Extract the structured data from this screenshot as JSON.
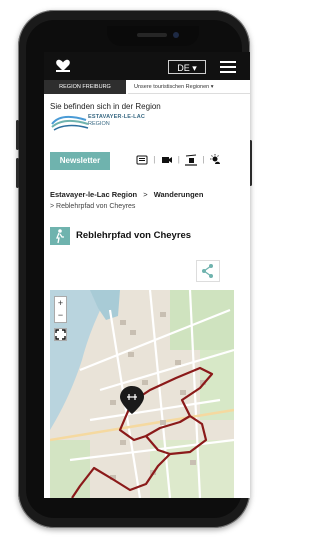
{
  "header": {
    "language": "DE ▾"
  },
  "region_bar": {
    "left": "REGION FREIBURG",
    "right": "Unsere touristischen Regionen ▾"
  },
  "region": {
    "intro": "Sie befinden sich in der Region",
    "name_line1": "ESTAVAYER-LE-LAC",
    "name_line2": "REGION"
  },
  "newsletter": {
    "label": "Newsletter"
  },
  "breadcrumb": {
    "item1": "Estavayer-le-Lac Region",
    "sep": ">",
    "item2": "Wanderungen",
    "sub": "> Reblehrpfad von Cheyres"
  },
  "page": {
    "title": "Reblehrpfad von Cheyres"
  },
  "map": {
    "zoom_in": "+",
    "zoom_out": "−"
  },
  "colors": {
    "accent": "#6fb3ae",
    "route": "#8b1a1a",
    "topbar": "#111111"
  }
}
